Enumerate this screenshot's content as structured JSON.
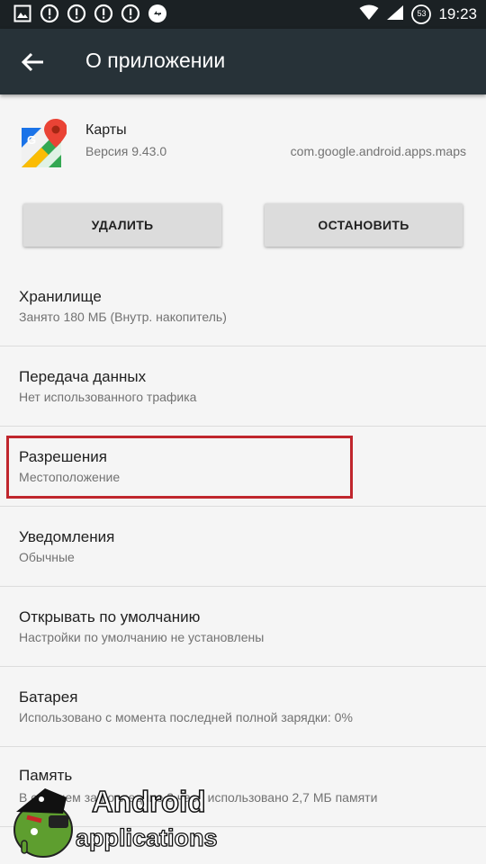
{
  "status_bar": {
    "time": "19:23",
    "battery_level": "53",
    "left_icons": [
      "image-icon",
      "alert-icon",
      "alert-icon",
      "alert-icon",
      "alert-icon",
      "sync-icon"
    ],
    "right_icons": [
      "wifi-icon",
      "signal-icon",
      "battery-icon"
    ]
  },
  "app_bar": {
    "title": "О приложении",
    "back_icon": "arrow-back-icon"
  },
  "app": {
    "name": "Карты",
    "version": "Версия 9.43.0",
    "package": "com.google.android.apps.maps",
    "icon": "google-maps-icon"
  },
  "buttons": {
    "uninstall": "УДАЛИТЬ",
    "stop": "ОСТАНОВИТЬ"
  },
  "settings": [
    {
      "title": "Хранилище",
      "subtitle": "Занято 180 МБ (Внутр. накопитель)"
    },
    {
      "title": "Передача данных",
      "subtitle": "Нет использованного трафика"
    },
    {
      "title": "Разрешения",
      "subtitle": "Местоположение"
    },
    {
      "title": "Уведомления",
      "subtitle": "Обычные"
    },
    {
      "title": "Открывать по умолчанию",
      "subtitle": "Настройки по умолчанию не установлены"
    },
    {
      "title": "Батарея",
      "subtitle": "Использовано с момента последней полной зарядки: 0%"
    },
    {
      "title": "Память",
      "subtitle": "В среднем за последние 3 часа использовано 2,7 МБ памяти"
    }
  ],
  "watermark": {
    "line1": "Android",
    "line2": "applications"
  },
  "colors": {
    "status_bar": "#1b2124",
    "app_bar": "#273238",
    "highlight": "#c0262d",
    "background": "#f5f5f5"
  }
}
